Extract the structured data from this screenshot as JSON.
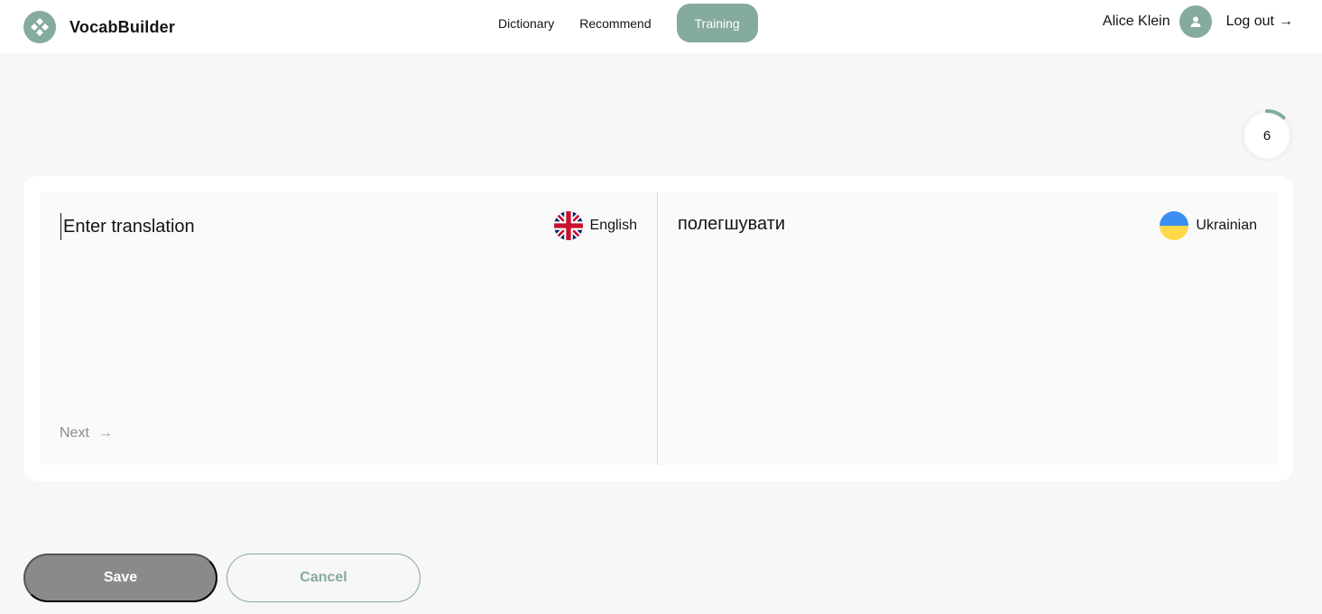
{
  "app": {
    "name": "VocabBuilder"
  },
  "nav": {
    "items": [
      {
        "label": "Dictionary",
        "active": false
      },
      {
        "label": "Recommend",
        "active": false
      },
      {
        "label": "Training",
        "active": true
      }
    ]
  },
  "user": {
    "name": "Alice Klein",
    "logout_label": "Log out"
  },
  "progress": {
    "count": "6",
    "fraction": 0.12
  },
  "training": {
    "input_placeholder": "Enter translation",
    "source_language": "English",
    "target_language": "Ukrainian",
    "word": "полегшувати",
    "next_label": "Next"
  },
  "actions": {
    "save_label": "Save",
    "cancel_label": "Cancel"
  },
  "colors": {
    "accent": "#85aa9f",
    "background": "#f7f7f7",
    "disabled": "#8a8a8a"
  }
}
